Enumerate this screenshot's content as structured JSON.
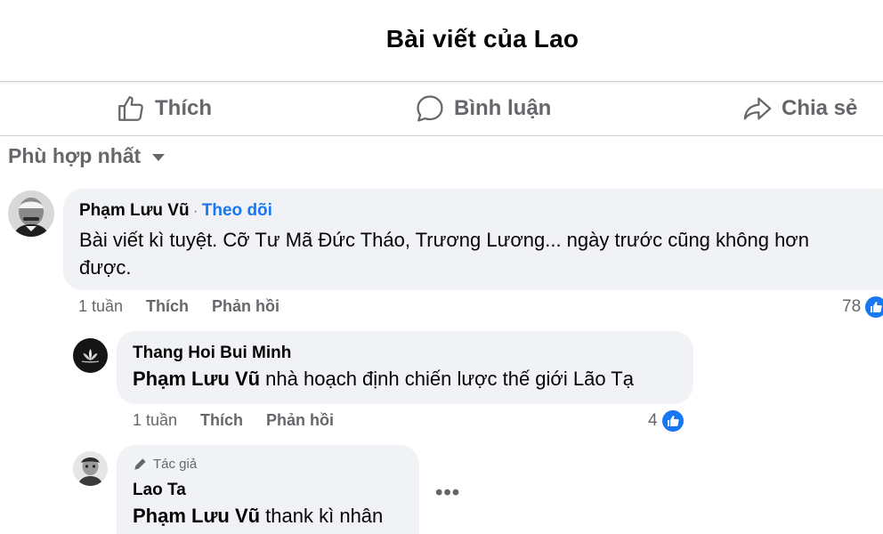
{
  "header": {
    "title": "Bài viết của Lao"
  },
  "actions": {
    "like": "Thích",
    "comment": "Bình luận",
    "share": "Chia sẻ"
  },
  "sort": {
    "label": "Phù hợp nhất"
  },
  "comments": [
    {
      "author": "Phạm Lưu Vũ",
      "separator": "·",
      "follow": "Theo dõi",
      "text_line1": "Bài viết kì tuyệt. Cỡ Tư Mã Đức Tháo, Trương Lương... ngày trước cũng không hơn",
      "text_line2": "được.",
      "time": "1 tuần",
      "like": "Thích",
      "reply": "Phản hồi",
      "reactions": "78"
    },
    {
      "author": "Thang Hoi Bui Minh",
      "mention": "Phạm Lưu Vũ",
      "text": " nhà hoạch định chiến lược thế giới Lão Tạ",
      "time": "1 tuần",
      "like": "Thích",
      "reply": "Phản hồi",
      "reactions": "4"
    },
    {
      "badge": "Tác giả",
      "author": "Lao Ta",
      "mention": "Phạm Lưu Vũ",
      "text": " thank kì nhân",
      "more": "•••"
    }
  ],
  "colors": {
    "accent": "#1877f2",
    "secondary_text": "#65676b",
    "bubble": "#f0f2f5"
  },
  "icons": {
    "like": "thumbs-up-icon",
    "comment": "speech-bubble-icon",
    "share": "share-arrow-icon",
    "sort": "caret-down-icon",
    "author_badge": "pencil-icon"
  }
}
